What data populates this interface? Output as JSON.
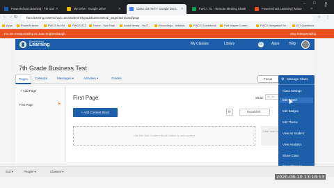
{
  "browser": {
    "tabs": [
      {
        "title": "PowerSchool Learning - 7th Gra",
        "color": "#1c5fa8",
        "active": false
      },
      {
        "title": "My Drive - Google Drive",
        "color": "#f4b400",
        "active": false
      },
      {
        "title": "Class List Tech - Google Docs",
        "color": "#4285f4",
        "active": true
      },
      {
        "title": "FWCT 7/1 - Remote Meeting Ideas",
        "color": "#0f9d58",
        "active": false
      },
      {
        "title": "PowerSchool Learning | Mana",
        "color": "#e8501f",
        "active": false
      }
    ],
    "url": "fwcs.learning.powerschool.com/student/7thgradebusinesstest/_page/dashboard/page",
    "bookmarks": [
      "Apps",
      "PowerTeacher",
      "FWCS Inc Ed",
      "FWCS.K12",
      "Home - SumTotal",
      "Audio library - YouT...",
      "Recordings - Indiana...",
      "FWCS Gradebook",
      "Fort Wayne Comm...",
      "FWCS Integrated Se...",
      "IUT Questions"
    ]
  },
  "masquerade": {
    "text": "You are masquerading as Juan Brightenbaugh.",
    "stop_label": "Stop Masquerading"
  },
  "header": {
    "brand_small": "PowerSchool",
    "brand": "Learning",
    "nav": [
      "My Classes",
      "Library",
      "Apps",
      "Help"
    ]
  },
  "course": {
    "title": "7th Grade Business Test",
    "tabs": [
      "Pages",
      "Calendar",
      "Messages ▾",
      "Activities ▾",
      "Grades"
    ],
    "focus_label": "Focus"
  },
  "left_panel": {
    "add_page": "+ Add Page",
    "first_page": "First Page"
  },
  "main": {
    "page_title": "First Page",
    "show_label": "Show:",
    "show_value": "All Se...",
    "add_block": "+ Add Content Block",
    "unpublish": "Unpublish",
    "empty_text": "Use the 'Add Content Block' button to add content",
    "side_text": "Click 'Add Content Block' to..."
  },
  "manage": {
    "button": "Manage Class",
    "items": [
      "Class Settings",
      "Edit Roster",
      "Edit Badges",
      "Edit Theme",
      "View as Student",
      "View Analytics",
      "Share Class",
      "Save Class As"
    ]
  },
  "footer": {
    "items": [
      "Grd ▾",
      "People ▾",
      "Classes ▾"
    ]
  },
  "timestamp": "2020-08-10 13:18:13"
}
